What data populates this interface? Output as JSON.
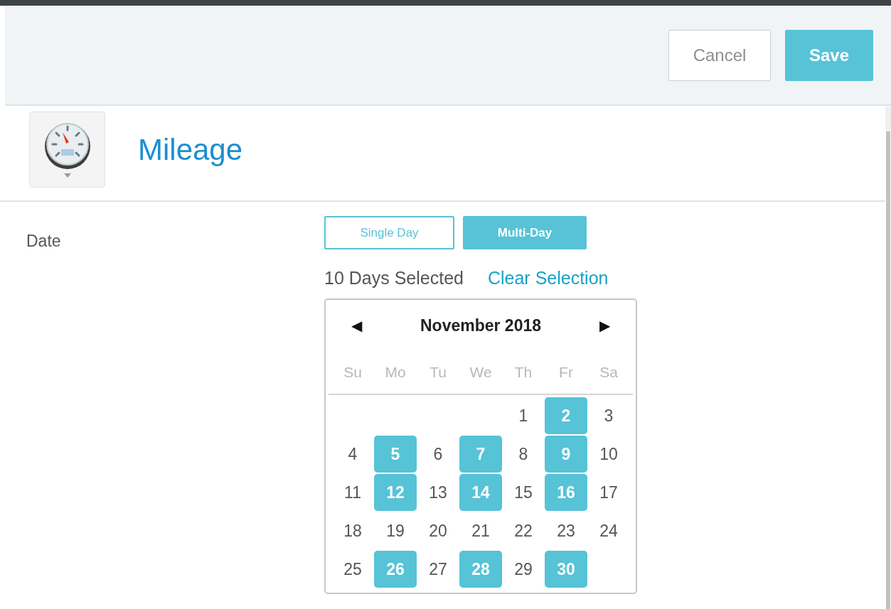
{
  "header": {
    "buttons": [
      {
        "label": "Cancel",
        "kind": "secondary"
      },
      {
        "label": "Save",
        "kind": "primary"
      }
    ]
  },
  "title": "Mileage",
  "field": {
    "label": "Date",
    "modes": [
      {
        "label": "Single Day",
        "selected": false
      },
      {
        "label": "Multi-Day",
        "selected": true
      }
    ],
    "summary": "10 Days Selected",
    "clear_link": "Clear Selection"
  },
  "calendar": {
    "prev": "◀",
    "next": "▶",
    "month": "November 2018",
    "weekdays": [
      "Su",
      "Mo",
      "Tu",
      "We",
      "Th",
      "Fr",
      "Sa"
    ],
    "weeks": [
      [
        {
          "day": "1",
          "selected": false
        },
        {
          "day": "2",
          "selected": true
        },
        {
          "day": "3",
          "selected": false
        }
      ],
      [
        {
          "day": "4",
          "selected": false
        },
        {
          "day": "5",
          "selected": true
        },
        {
          "day": "6",
          "selected": false
        },
        {
          "day": "7",
          "selected": true
        },
        {
          "day": "8",
          "selected": false
        },
        {
          "day": "9",
          "selected": true
        },
        {
          "day": "10",
          "selected": false
        }
      ],
      [
        {
          "day": "11",
          "selected": false
        },
        {
          "day": "12",
          "selected": true
        },
        {
          "day": "13",
          "selected": false
        },
        {
          "day": "14",
          "selected": true
        },
        {
          "day": "15",
          "selected": false
        },
        {
          "day": "16",
          "selected": true
        },
        {
          "day": "17",
          "selected": false
        }
      ],
      [
        {
          "day": "18",
          "selected": false
        },
        {
          "day": "19",
          "selected": false
        },
        {
          "day": "20",
          "selected": false
        },
        {
          "day": "21",
          "selected": false
        },
        {
          "day": "22",
          "selected": false
        },
        {
          "day": "23",
          "selected": false
        },
        {
          "day": "24",
          "selected": false
        }
      ],
      [
        {
          "day": "25",
          "selected": false
        },
        {
          "day": "26",
          "selected": true
        },
        {
          "day": "27",
          "selected": false
        },
        {
          "day": "28",
          "selected": true
        },
        {
          "day": "29",
          "selected": false
        },
        {
          "day": "30",
          "selected": true
        }
      ]
    ]
  }
}
